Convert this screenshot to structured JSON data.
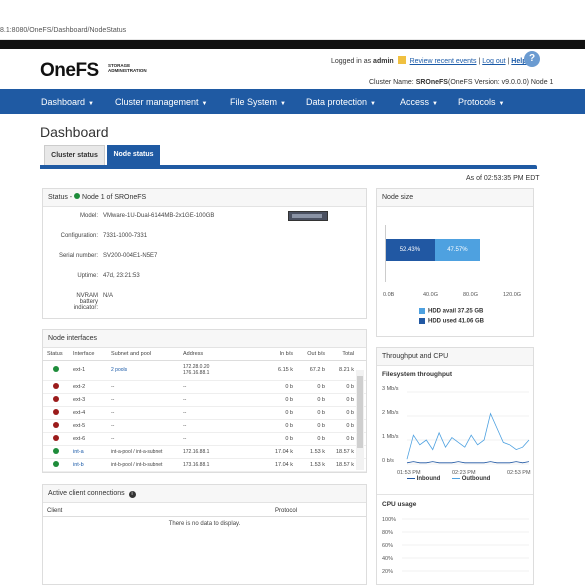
{
  "browser": {
    "url": "8.1:8080/OneFS/Dashboard/NodeStatus"
  },
  "header": {
    "logo": "OneFS",
    "logo_sub": "STORAGE ADMINISTRATION",
    "logged_in_prefix": "Logged in as",
    "user": "admin",
    "review_link": "Review recent events",
    "logout_link": "Log out",
    "help_link": "Help",
    "cluster_prefix": "Cluster Name:",
    "cluster_name": "SROneFS",
    "cluster_suffix": "(OneFS Version: v9.0.0.0) Node 1"
  },
  "nav": {
    "items": [
      "Dashboard",
      "Cluster management",
      "File System",
      "Data protection",
      "Access",
      "Protocols"
    ],
    "caret": "▼"
  },
  "page": {
    "title": "Dashboard",
    "tabs": [
      "Cluster status",
      "Node status"
    ],
    "as_of": "As of 02:53:35 PM EDT"
  },
  "status": {
    "head": "Status -",
    "node": "Node 1 of SROneFS",
    "labels": [
      "Model:",
      "Configuration:",
      "Serial number:",
      "Uptime:",
      "NVRAM battery indicator:"
    ],
    "values": [
      "VMware-1U-Dual-6144MB-2x1GE-100GB",
      "7331-1000-7331",
      "SV200-004E1-N5E7",
      "47d, 23:21:53",
      "N/A"
    ]
  },
  "interfaces": {
    "head": "Node interfaces",
    "columns": [
      "Status",
      "Interface",
      "Subnet and pool",
      "Address",
      "In b/s",
      "Out b/s",
      "Total"
    ],
    "rows": [
      {
        "status": "green",
        "iface": "ext-1",
        "subnet": "2 pools",
        "addr": "172.28.0.20\n176.16.88.1",
        "in": "6.15 k",
        "out": "67.2 b",
        "total": "8.21 k"
      },
      {
        "status": "red",
        "iface": "ext-2",
        "subnet": "--",
        "addr": "--",
        "in": "0 b",
        "out": "0 b",
        "total": "0 b"
      },
      {
        "status": "red",
        "iface": "ext-3",
        "subnet": "--",
        "addr": "--",
        "in": "0 b",
        "out": "0 b",
        "total": "0 b"
      },
      {
        "status": "red",
        "iface": "ext-4",
        "subnet": "--",
        "addr": "--",
        "in": "0 b",
        "out": "0 b",
        "total": "0 b"
      },
      {
        "status": "red",
        "iface": "ext-5",
        "subnet": "--",
        "addr": "--",
        "in": "0 b",
        "out": "0 b",
        "total": "0 b"
      },
      {
        "status": "red",
        "iface": "ext-6",
        "subnet": "--",
        "addr": "--",
        "in": "0 b",
        "out": "0 b",
        "total": "0 b"
      },
      {
        "status": "green",
        "iface": "int-a",
        "subnet": "int-a-pool / int-a-subnet",
        "addr": "172.16.88.1",
        "in": "17.04 k",
        "out": "1.53 k",
        "total": "18.57 k"
      },
      {
        "status": "green",
        "iface": "int-b",
        "subnet": "int-b-pool / int-b-subnet",
        "addr": "173.16.88.1",
        "in": "17.04 k",
        "out": "1.53 k",
        "total": "18.57 k"
      }
    ]
  },
  "clients": {
    "head": "Active client connections",
    "info_icon": "info-icon",
    "columns": [
      "Client",
      "Protocol"
    ],
    "empty": "There is no data to display."
  },
  "node_size": {
    "head": "Node size",
    "segments": [
      {
        "label": "52.43%",
        "color": "#2158a3",
        "fraction": 0.5243
      },
      {
        "label": "47.57%",
        "color": "#4ea1e0",
        "fraction": 0.4757
      }
    ],
    "ticks": [
      "0.0B",
      "40.0G",
      "80.0G",
      "120.0G"
    ],
    "legend": [
      {
        "text": "HDD avail 37.25 GB",
        "color": "#4ea1e0"
      },
      {
        "text": "HDD used 41.06 GB",
        "color": "#2158a3"
      }
    ]
  },
  "throughput": {
    "head": "Throughput and CPU",
    "chart_title": "Filesystem throughput",
    "yticks": [
      "3 Mb/s",
      "2 Mb/s",
      "1 Mb/s",
      "0 b/s"
    ],
    "xticks": [
      "01:53 PM",
      "02:23 PM",
      "02:53 PM"
    ],
    "legend": [
      "Inbound",
      "Outbound"
    ],
    "colors": {
      "inbound": "#2158a3",
      "outbound": "#4ea1e0"
    }
  },
  "cpu": {
    "head": "CPU usage",
    "yticks": [
      "100%",
      "80%",
      "60%",
      "40%",
      "20%"
    ]
  },
  "chart_data": {
    "type": "line",
    "title": "Filesystem throughput",
    "xlabel": "",
    "ylabel": "",
    "ylim": [
      0,
      3
    ],
    "x": [
      "01:53 PM",
      "02:23 PM",
      "02:53 PM"
    ],
    "series": [
      {
        "name": "Inbound",
        "values": [
          0.05,
          0.1,
          0.05,
          0.05,
          0.1,
          0.05,
          0.05,
          0.05,
          0.1,
          0.05,
          0.05,
          0.05,
          0.05,
          0.1,
          0.05,
          0.05,
          0.05,
          0.1,
          0.05,
          0.1
        ]
      },
      {
        "name": "Outbound",
        "values": [
          0.2,
          1.2,
          0.8,
          1.0,
          0.6,
          1.3,
          0.7,
          1.1,
          0.9,
          0.7,
          1.2,
          0.8,
          1.0,
          2.1,
          1.5,
          0.9,
          0.8,
          0.6,
          0.7,
          1.0
        ]
      }
    ]
  }
}
